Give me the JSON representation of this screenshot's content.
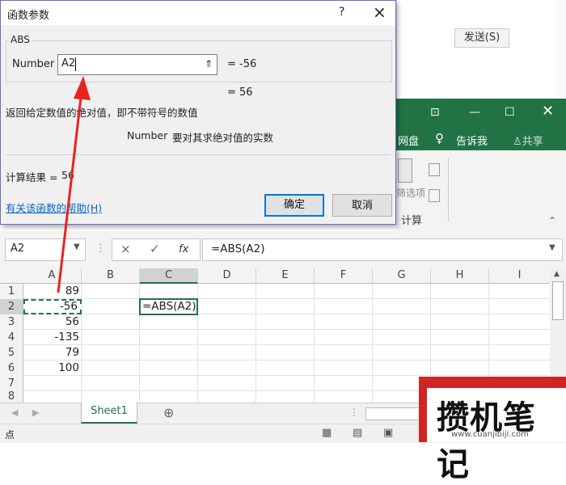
{
  "chat": {
    "send_label": "发送(S)"
  },
  "excel": {
    "ribbon": {
      "netdisk": "网盘",
      "tellme": "告诉我",
      "share": "共享",
      "filter_frag": "筛选项",
      "group_calc": "计算"
    },
    "name_box": "A2",
    "formula": "=ABS(A2)",
    "cancel_icon": "×",
    "enter_icon": "✓",
    "fx_label": "fx",
    "columns": [
      "A",
      "B",
      "C",
      "D",
      "E",
      "F",
      "G",
      "H",
      "I"
    ],
    "rows": [
      "1",
      "2",
      "3",
      "4",
      "5",
      "6",
      "7",
      "8"
    ],
    "col_a_values": [
      "89",
      "-56",
      "56",
      "-135",
      "79",
      "100"
    ],
    "c2_value": "=ABS(A2)",
    "sheet_tab": "Sheet1",
    "add_sheet": "⊕",
    "status_text": "点"
  },
  "dialog": {
    "title": "函数参数",
    "help_q": "?",
    "close": "×",
    "func_name": "ABS",
    "arg_label": "Number",
    "arg_value": "A2",
    "arg_eval": "=  -56",
    "result_eval": "=  56",
    "description": "返回给定数值的绝对值，即不带符号的数值",
    "arg_desc_name": "Number",
    "arg_desc_text": "要对其求绝对值的实数",
    "calc_result_label": "计算结果 =",
    "calc_result_value": "56",
    "help_link": "有关该函数的帮助(H)",
    "ok_label": "确定",
    "cancel_label": "取消"
  },
  "watermark": {
    "brand": "攒机笔记",
    "url": "www.cuanjibiji.com"
  }
}
